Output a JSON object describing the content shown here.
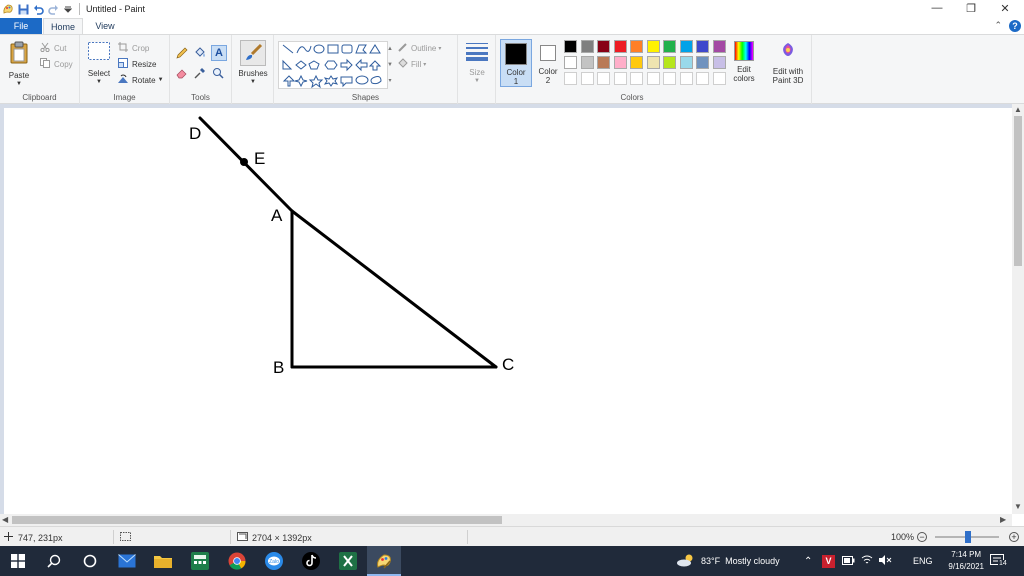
{
  "window": {
    "title": "Untitled - Paint",
    "minimize_glyph": "—",
    "restore_glyph": "❐",
    "close_glyph": "✕"
  },
  "tabs": {
    "file": "File",
    "home": "Home",
    "view": "View",
    "help": "?"
  },
  "clipboard": {
    "label": "Clipboard",
    "paste": "Paste",
    "cut": "Cut",
    "copy": "Copy"
  },
  "image": {
    "label": "Image",
    "select": "Select",
    "crop": "Crop",
    "resize": "Resize",
    "rotate": "Rotate"
  },
  "tools": {
    "label": "Tools"
  },
  "brushes": {
    "label": "Brushes"
  },
  "shapes": {
    "label": "Shapes",
    "outline": "Outline",
    "fill": "Fill"
  },
  "size": {
    "label": "Size"
  },
  "color1": {
    "label": "Color",
    "number": "1",
    "value": "#000000"
  },
  "color2": {
    "label": "Color",
    "number": "2",
    "value": "#ffffff"
  },
  "colors": {
    "label": "Colors",
    "edit": "Edit colors",
    "paint3d": "Edit with Paint 3D",
    "palette_row1": [
      "#000000",
      "#7f7f7f",
      "#880015",
      "#ed1c24",
      "#ff7f27",
      "#fff200",
      "#22b14c",
      "#00a2e8",
      "#3f48cc",
      "#a349a4"
    ],
    "palette_row2": [
      "#ffffff",
      "#c3c3c3",
      "#b97a57",
      "#ffaec9",
      "#ffc90e",
      "#efe4b0",
      "#b5e61d",
      "#99d9ea",
      "#7092be",
      "#c8bfe7"
    ]
  },
  "drawing": {
    "points": {
      "D": "D",
      "E": "E",
      "A": "A",
      "B": "B",
      "C": "C"
    }
  },
  "status": {
    "cursor_pos": "747, 231px",
    "image_size": "2704 × 1392px",
    "zoom": "100%"
  },
  "taskbar": {
    "weather_temp": "83°F",
    "weather_desc": "Mostly cloudy",
    "language": "ENG",
    "time": "7:14 PM",
    "date": "9/16/2021",
    "notifications": "14"
  }
}
